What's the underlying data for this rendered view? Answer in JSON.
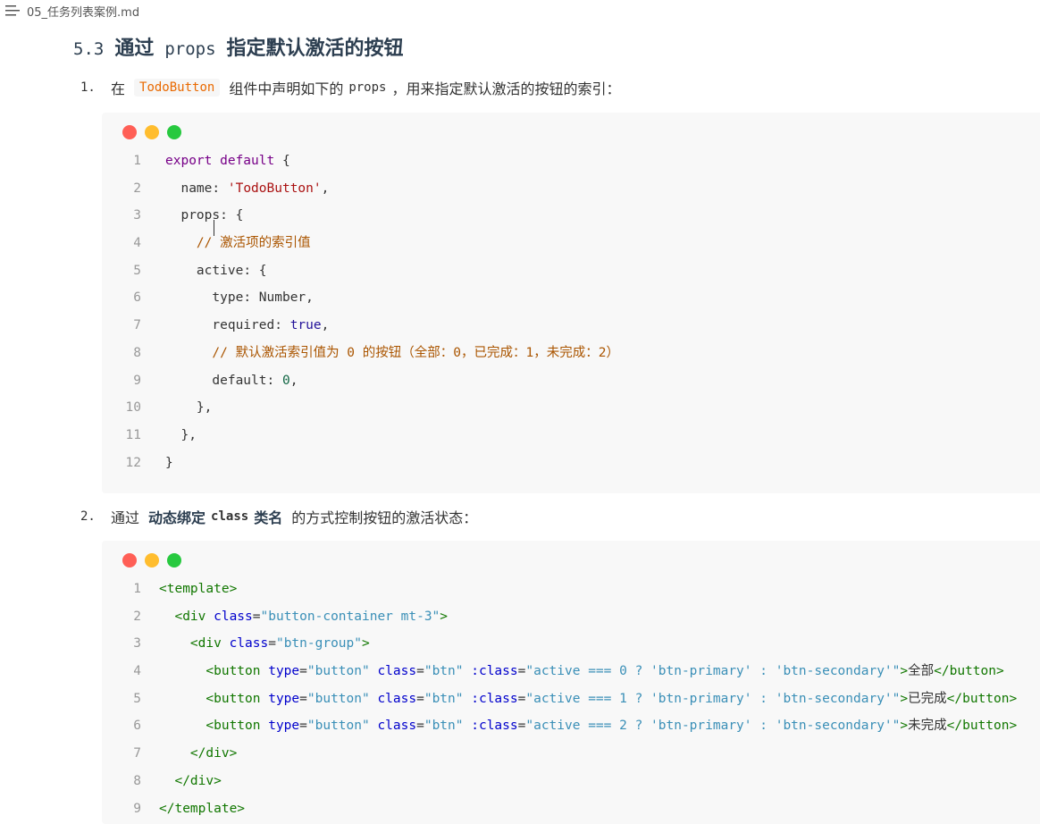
{
  "topbar": {
    "filename": "05_任务列表案例.md"
  },
  "heading": {
    "number": "5.3",
    "pre": "通过",
    "code": "props",
    "post": "指定默认激活的按钮"
  },
  "item1": {
    "marker": "1.",
    "text_pre": "在",
    "code": "TodoButton",
    "text_mid": "组件中声明如下的",
    "code2": "props",
    "text_post": "，用来指定默认激活的按钮的索引："
  },
  "item2": {
    "marker": "2.",
    "text_pre": "通过",
    "strong1": "动态绑定",
    "code": "class",
    "strong2": "类名",
    "text_post": "的方式控制按钮的激活状态："
  },
  "window_dots": {
    "red": "#ff5f56",
    "yellow": "#ffbd2e",
    "green": "#27c93f"
  },
  "code1": {
    "line_numbers": [
      "1",
      "2",
      "3",
      "4",
      "5",
      "6",
      "7",
      "8",
      "9",
      "10",
      "11",
      "12"
    ],
    "lines": [
      [
        {
          "t": "export default",
          "c": "kw"
        },
        {
          "t": " {",
          "c": ""
        }
      ],
      [
        {
          "t": "  name",
          "c": ""
        },
        {
          "t": ": ",
          "c": ""
        },
        {
          "t": "'TodoButton'",
          "c": "str2"
        },
        {
          "t": ",",
          "c": ""
        }
      ],
      [
        {
          "t": "  props",
          "c": ""
        },
        {
          "t": ": {",
          "c": ""
        }
      ],
      [
        {
          "t": "    // 激活项的索引值",
          "c": "cmt"
        }
      ],
      [
        {
          "t": "    active",
          "c": ""
        },
        {
          "t": ": {",
          "c": ""
        }
      ],
      [
        {
          "t": "      type",
          "c": ""
        },
        {
          "t": ": Number,",
          "c": ""
        }
      ],
      [
        {
          "t": "      required",
          "c": ""
        },
        {
          "t": ": ",
          "c": ""
        },
        {
          "t": "true",
          "c": "atom"
        },
        {
          "t": ",",
          "c": ""
        }
      ],
      [
        {
          "t": "      // 默认激活索引值为 0 的按钮（全部：0，已完成：1，未完成：2）",
          "c": "cmt"
        }
      ],
      [
        {
          "t": "      default",
          "c": ""
        },
        {
          "t": ": ",
          "c": ""
        },
        {
          "t": "0",
          "c": "num-lit"
        },
        {
          "t": ",",
          "c": ""
        }
      ],
      [
        {
          "t": "    },",
          "c": ""
        }
      ],
      [
        {
          "t": "  },",
          "c": ""
        }
      ],
      [
        {
          "t": "}",
          "c": ""
        }
      ]
    ]
  },
  "code2": {
    "line_numbers": [
      "1",
      "2",
      "3",
      "4",
      "5",
      "6",
      "7",
      "8",
      "9"
    ],
    "lines": [
      [
        {
          "t": "<template>",
          "c": "tag"
        }
      ],
      [
        {
          "t": "  <div ",
          "c": "tag"
        },
        {
          "t": "class",
          "c": "attr"
        },
        {
          "t": "=",
          "c": ""
        },
        {
          "t": "\"button-container mt-3\"",
          "c": "str"
        },
        {
          "t": ">",
          "c": "tag"
        }
      ],
      [
        {
          "t": "    <div ",
          "c": "tag"
        },
        {
          "t": "class",
          "c": "attr"
        },
        {
          "t": "=",
          "c": ""
        },
        {
          "t": "\"btn-group\"",
          "c": "str"
        },
        {
          "t": ">",
          "c": "tag"
        }
      ],
      [
        {
          "t": "      <button ",
          "c": "tag"
        },
        {
          "t": "type",
          "c": "attr"
        },
        {
          "t": "=",
          "c": ""
        },
        {
          "t": "\"button\" ",
          "c": "str"
        },
        {
          "t": "class",
          "c": "attr"
        },
        {
          "t": "=",
          "c": ""
        },
        {
          "t": "\"btn\" ",
          "c": "str"
        },
        {
          "t": ":class",
          "c": "attr"
        },
        {
          "t": "=",
          "c": ""
        },
        {
          "t": "\"active === 0 ? 'btn-primary' : 'btn-secondary'\"",
          "c": "str"
        },
        {
          "t": ">",
          "c": "tag"
        },
        {
          "t": "全部",
          "c": ""
        },
        {
          "t": "</button>",
          "c": "tag"
        }
      ],
      [
        {
          "t": "      <button ",
          "c": "tag"
        },
        {
          "t": "type",
          "c": "attr"
        },
        {
          "t": "=",
          "c": ""
        },
        {
          "t": "\"button\" ",
          "c": "str"
        },
        {
          "t": "class",
          "c": "attr"
        },
        {
          "t": "=",
          "c": ""
        },
        {
          "t": "\"btn\" ",
          "c": "str"
        },
        {
          "t": ":class",
          "c": "attr"
        },
        {
          "t": "=",
          "c": ""
        },
        {
          "t": "\"active === 1 ? 'btn-primary' : 'btn-secondary'\"",
          "c": "str"
        },
        {
          "t": ">",
          "c": "tag"
        },
        {
          "t": "已完成",
          "c": ""
        },
        {
          "t": "</button>",
          "c": "tag"
        }
      ],
      [
        {
          "t": "      <button ",
          "c": "tag"
        },
        {
          "t": "type",
          "c": "attr"
        },
        {
          "t": "=",
          "c": ""
        },
        {
          "t": "\"button\" ",
          "c": "str"
        },
        {
          "t": "class",
          "c": "attr"
        },
        {
          "t": "=",
          "c": ""
        },
        {
          "t": "\"btn\" ",
          "c": "str"
        },
        {
          "t": ":class",
          "c": "attr"
        },
        {
          "t": "=",
          "c": ""
        },
        {
          "t": "\"active === 2 ? 'btn-primary' : 'btn-secondary'\"",
          "c": "str"
        },
        {
          "t": ">",
          "c": "tag"
        },
        {
          "t": "未完成",
          "c": ""
        },
        {
          "t": "</button>",
          "c": "tag"
        }
      ],
      [
        {
          "t": "    </div>",
          "c": "tag"
        }
      ],
      [
        {
          "t": "  </div>",
          "c": "tag"
        }
      ],
      [
        {
          "t": "</template>",
          "c": "tag"
        }
      ]
    ]
  }
}
